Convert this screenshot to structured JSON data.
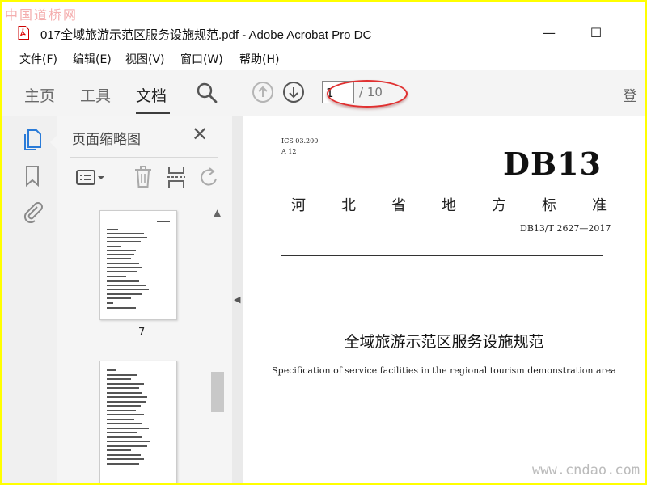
{
  "watermarks": {
    "top": "中国道桥网",
    "bottom": "www.cndao.com"
  },
  "window": {
    "title": "017全域旅游示范区服务设施规范.pdf - Adobe Acrobat Pro DC",
    "minimize": "—",
    "maximize": "☐"
  },
  "menu": {
    "items": [
      "文件(F)",
      "编辑(E)",
      "视图(V)",
      "窗口(W)",
      "帮助(H)"
    ]
  },
  "toolbar": {
    "tabs": [
      "主页",
      "工具",
      "文档"
    ],
    "active_tab": "文档",
    "page_current": "1",
    "page_total": "/ 10",
    "overflow_label": "登",
    "highlight_color": "#e03030"
  },
  "sidebar_panel": {
    "title": "页面缩略图",
    "close": "✕",
    "thumbnails": [
      {
        "page_label": "7"
      },
      {
        "page_label": ""
      }
    ]
  },
  "document": {
    "ics_code": "ICS 03.200",
    "class_code": "A 12",
    "standard_code": "DB13",
    "standard_type_chars": [
      "河",
      "北",
      "省",
      "地",
      "方",
      "标",
      "准"
    ],
    "standard_number": "DB13/T 2627—2017",
    "title_cn": "全域旅游示范区服务设施规范",
    "title_en": "Specification of service facilities in the regional tourism demonstration area"
  }
}
